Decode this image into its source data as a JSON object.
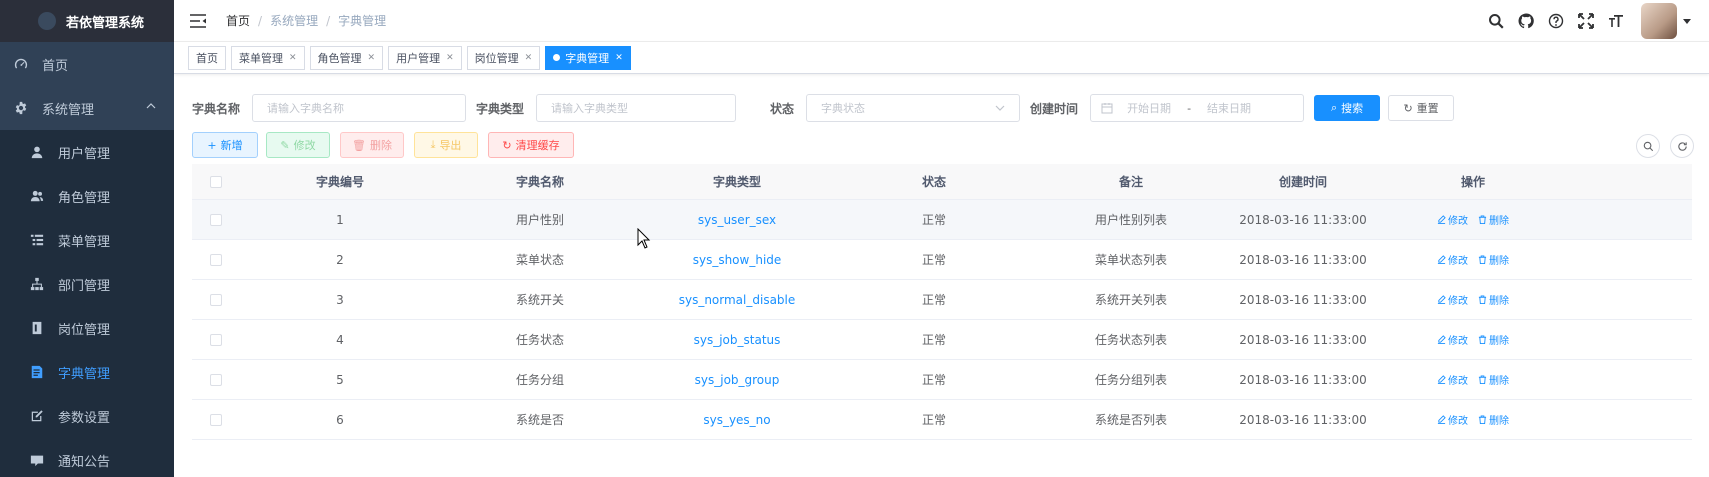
{
  "app": {
    "title": "若依管理系统"
  },
  "sidebar": {
    "items": [
      {
        "label": "首页",
        "icon": "dashboard-icon"
      },
      {
        "label": "系统管理",
        "icon": "gear-icon"
      },
      {
        "label": "用户管理",
        "icon": "user-icon"
      },
      {
        "label": "角色管理",
        "icon": "peoples-icon"
      },
      {
        "label": "菜单管理",
        "icon": "tree-table-icon"
      },
      {
        "label": "部门管理",
        "icon": "tree-icon"
      },
      {
        "label": "岗位管理",
        "icon": "post-icon"
      },
      {
        "label": "字典管理",
        "icon": "dict-icon"
      },
      {
        "label": "参数设置",
        "icon": "edit-icon"
      },
      {
        "label": "通知公告",
        "icon": "message-icon"
      }
    ],
    "active_color": "#409eff",
    "bg_color": "#304156"
  },
  "navbar": {
    "breadcrumb": [
      "首页",
      "系统管理",
      "字典管理"
    ],
    "separator": "/",
    "tools": [
      "search-icon",
      "github-icon",
      "question-icon",
      "fullscreen-icon",
      "font-size-icon"
    ]
  },
  "tags": [
    {
      "label": "首页"
    },
    {
      "label": "菜单管理"
    },
    {
      "label": "角色管理"
    },
    {
      "label": "用户管理"
    },
    {
      "label": "岗位管理"
    },
    {
      "label": "字典管理",
      "active": true
    }
  ],
  "search": {
    "dict_name_label": "字典名称",
    "dict_name_placeholder": "请输入字典名称",
    "dict_type_label": "字典类型",
    "dict_type_placeholder": "请输入字典类型",
    "status_label": "状态",
    "status_placeholder": "字典状态",
    "created_label": "创建时间",
    "start_placeholder": "开始日期",
    "range_sep": "-",
    "end_placeholder": "结束日期",
    "search_btn": "搜索",
    "reset_btn": "重置"
  },
  "actions": {
    "add": "新增",
    "edit": "修改",
    "delete": "删除",
    "export": "导出",
    "clear_cache": "清理缓存"
  },
  "table": {
    "columns": [
      "字典编号",
      "字典名称",
      "字典类型",
      "状态",
      "备注",
      "创建时间",
      "操作"
    ],
    "rows": [
      {
        "id": "1",
        "name": "用户性别",
        "type": "sys_user_sex",
        "status": "正常",
        "remark": "用户性别列表",
        "created": "2018-03-16 11:33:00"
      },
      {
        "id": "2",
        "name": "菜单状态",
        "type": "sys_show_hide",
        "status": "正常",
        "remark": "菜单状态列表",
        "created": "2018-03-16 11:33:00"
      },
      {
        "id": "3",
        "name": "系统开关",
        "type": "sys_normal_disable",
        "status": "正常",
        "remark": "系统开关列表",
        "created": "2018-03-16 11:33:00"
      },
      {
        "id": "4",
        "name": "任务状态",
        "type": "sys_job_status",
        "status": "正常",
        "remark": "任务状态列表",
        "created": "2018-03-16 11:33:00"
      },
      {
        "id": "5",
        "name": "任务分组",
        "type": "sys_job_group",
        "status": "正常",
        "remark": "任务分组列表",
        "created": "2018-03-16 11:33:00"
      },
      {
        "id": "6",
        "name": "系统是否",
        "type": "sys_yes_no",
        "status": "正常",
        "remark": "系统是否列表",
        "created": "2018-03-16 11:33:00"
      }
    ],
    "row_edit": "修改",
    "row_delete": "删除"
  }
}
